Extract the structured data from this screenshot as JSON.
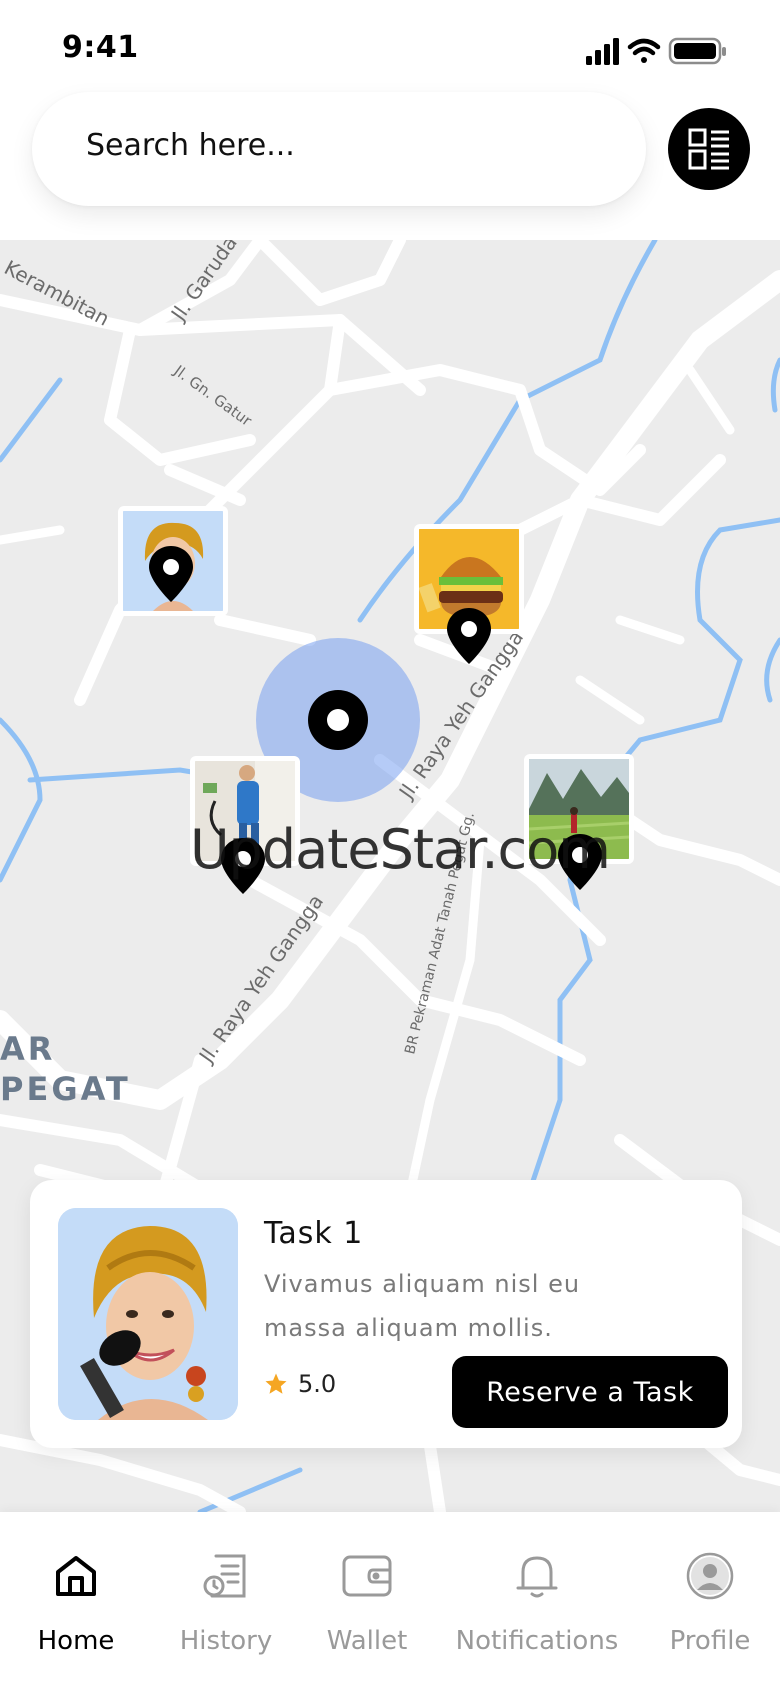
{
  "status_bar": {
    "time": "9:41"
  },
  "search": {
    "placeholder": "Search here..."
  },
  "map": {
    "street_labels": [
      "Kerambitan",
      "Jl. Garuda",
      "Jl. Gn. Gatur",
      "Jl. Raya Yeh Gangga",
      "Jl. Raya Yeh Gangga",
      "BR Pekraman Adat Tanah Pegat Gg."
    ],
    "area_labels": [
      "AR",
      "PEGAT"
    ],
    "watermark": "UpdateStar.com",
    "user_location_color": "#7aa2f0",
    "water_color": "#8fc0f4",
    "road_color": "#ffffff",
    "land_color": "#ececec"
  },
  "task_card": {
    "title": "Task 1",
    "description": "Vivamus aliquam nisl eu massa aliquam mollis.",
    "rating": "5.0",
    "button_label": "Reserve a Task",
    "star_color": "#f5a623"
  },
  "bottom_nav": {
    "items": [
      {
        "label": "Home",
        "icon": "home-icon",
        "active": true
      },
      {
        "label": "History",
        "icon": "history-icon",
        "active": false
      },
      {
        "label": "Wallet",
        "icon": "wallet-icon",
        "active": false
      },
      {
        "label": "Notifications",
        "icon": "bell-icon",
        "active": false
      },
      {
        "label": "Profile",
        "icon": "profile-icon",
        "active": false
      }
    ]
  }
}
